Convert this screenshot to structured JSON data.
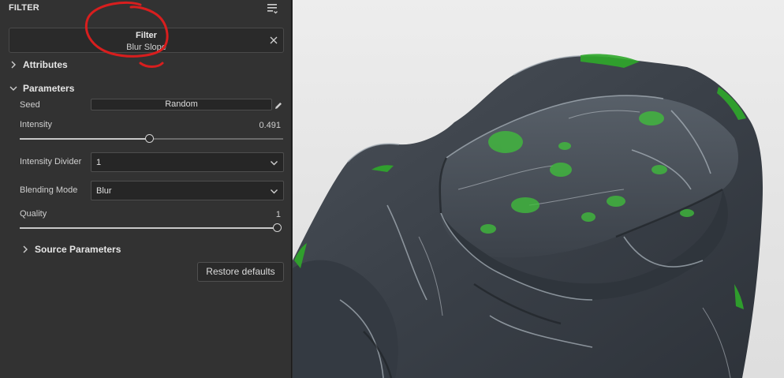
{
  "panel": {
    "title": "FILTER",
    "menu_icon": "list-menu-icon",
    "layer_card": {
      "type_label": "Filter",
      "name": "Blur Slope",
      "close_icon": "close-icon"
    }
  },
  "sections": {
    "attributes": {
      "label": "Attributes",
      "expanded": false
    },
    "parameters": {
      "label": "Parameters",
      "expanded": true
    },
    "source_parameters": {
      "label": "Source Parameters",
      "expanded": false
    }
  },
  "parameters": {
    "seed": {
      "label": "Seed",
      "button_label": "Random",
      "edit_icon": "pencil-icon"
    },
    "intensity": {
      "label": "Intensity",
      "value_text": "0.491",
      "value": 0.491,
      "min": 0,
      "max": 1
    },
    "intensity_divider": {
      "label": "Intensity Divider",
      "selected": "1"
    },
    "blending_mode": {
      "label": "Blending Mode",
      "selected": "Blur"
    },
    "quality": {
      "label": "Quality",
      "value_text": "1",
      "value": 1,
      "min": 0,
      "max": 1
    }
  },
  "restore_button": {
    "label": "Restore defaults"
  },
  "colors": {
    "panel_bg": "#323232",
    "annotation": "#d81e1e",
    "viewport_bg": "#e6e6e6",
    "rock_dark": "#3a4048",
    "rock_highlight": "#9aa4ad",
    "moss_green": "#3fc23a"
  }
}
